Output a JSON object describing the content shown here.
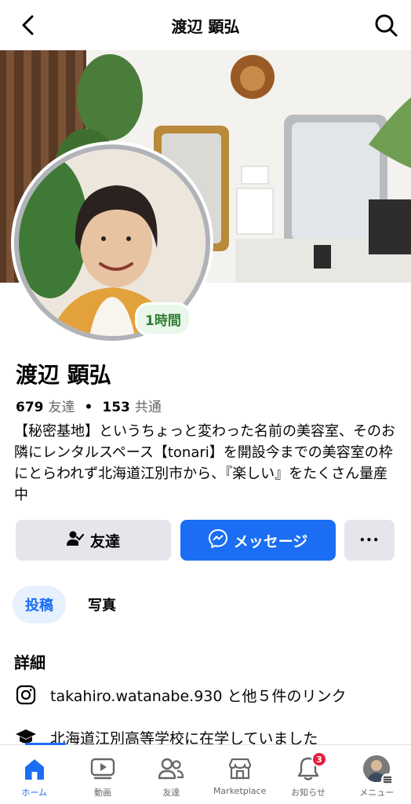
{
  "header": {
    "title": "渡辺 顕弘"
  },
  "profile": {
    "name": "渡辺 顕弘",
    "story_badge": "1時間",
    "friends_count": "679",
    "friends_label": "友達",
    "separator": "•",
    "mutual_count": "153",
    "mutual_label": "共通",
    "bio": "【秘密基地】というちょっと変わった名前の美容室、そのお隣にレンタルスペース【tonari】を開設今までの美容室の枠にとらわれず北海道江別市から、『楽しい』をたくさん量産中"
  },
  "actions": {
    "friends_label": "友達",
    "message_label": "メッセージ",
    "more_label": "•••"
  },
  "tabs": [
    {
      "label": "投稿"
    },
    {
      "label": "写真"
    }
  ],
  "details": {
    "title": "詳細",
    "instagram": "takahiro.watanabe.930 と他５件のリンク",
    "education": "北海道江別高等学校に在学していました"
  },
  "bottom_nav": [
    {
      "label": "ホーム",
      "icon": "home-icon"
    },
    {
      "label": "動画",
      "icon": "video-icon"
    },
    {
      "label": "友達",
      "icon": "friends-icon"
    },
    {
      "label": "Marketplace",
      "icon": "marketplace-icon"
    },
    {
      "label": "お知らせ",
      "icon": "bell-icon",
      "badge": "3"
    },
    {
      "label": "メニュー",
      "icon": "menu-avatar-icon"
    }
  ],
  "colors": {
    "accent": "#1b6ef3",
    "story_green": "#2e7d32",
    "badge_red": "#e41e3f"
  }
}
